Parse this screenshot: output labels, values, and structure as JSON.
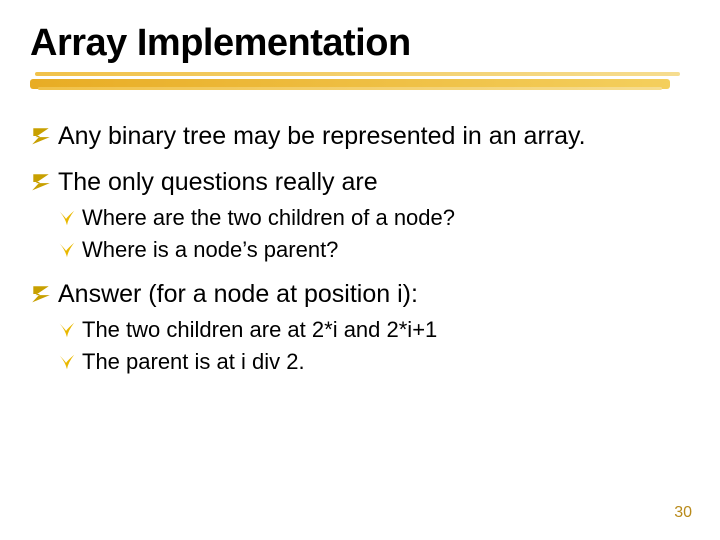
{
  "title": "Array Implementation",
  "top_points": [
    {
      "text": "Any binary tree may be represented in an array."
    },
    {
      "text": "The only questions really are",
      "subs": [
        "Where are the two children of a node?",
        "Where is a node’s parent?"
      ]
    },
    {
      "text": "Answer (for a node at position i):",
      "subs": [
        "The two children are at 2*i and 2*i+1",
        "The parent is at i div 2."
      ]
    }
  ],
  "page_number": "30",
  "colors": {
    "z_bullet": "#c8a000",
    "y_bullet": "#e9b800"
  }
}
